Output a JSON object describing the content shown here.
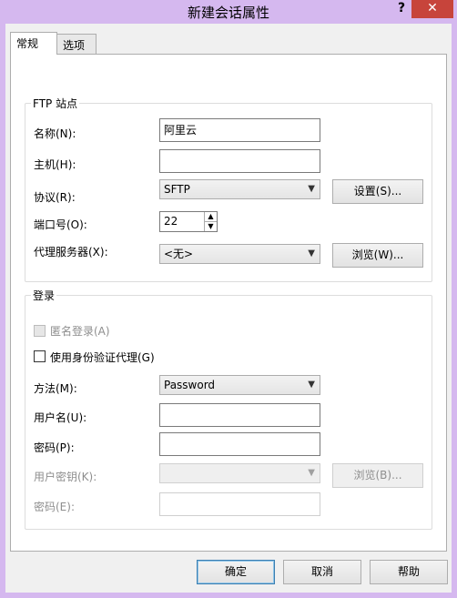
{
  "window": {
    "title": "新建会话属性",
    "help_label": "?",
    "close_label": "✕"
  },
  "tabs": [
    {
      "label": "常规",
      "active": true
    },
    {
      "label": "选项",
      "active": false
    }
  ],
  "ftp": {
    "legend": "FTP 站点",
    "name_label": "名称(N):",
    "name_value": "阿里云",
    "host_label": "主机(H):",
    "host_value": "",
    "protocol_label": "协议(R):",
    "protocol_value": "SFTP",
    "settings_button": "设置(S)...",
    "port_label": "端口号(O):",
    "port_value": "22",
    "proxy_label": "代理服务器(X):",
    "proxy_value": "<无>",
    "browse_button": "浏览(W)..."
  },
  "login": {
    "legend": "登录",
    "anonymous_label": "匿名登录(A)",
    "auth_agent_label": "使用身份验证代理(G)",
    "method_label": "方法(M):",
    "method_value": "Password",
    "username_label": "用户名(U):",
    "username_value": "",
    "password_label": "密码(P):",
    "password_value": "",
    "user_key_label": "用户密钥(K):",
    "user_key_value": "",
    "key_browse_button": "浏览(B)...",
    "passphrase_label": "密码(E):",
    "passphrase_value": ""
  },
  "footer": {
    "ok_button": "确定",
    "cancel_button": "取消",
    "help_button": "帮助"
  },
  "colors": {
    "frame": "#d5b8ef",
    "close": "#c7443b"
  }
}
